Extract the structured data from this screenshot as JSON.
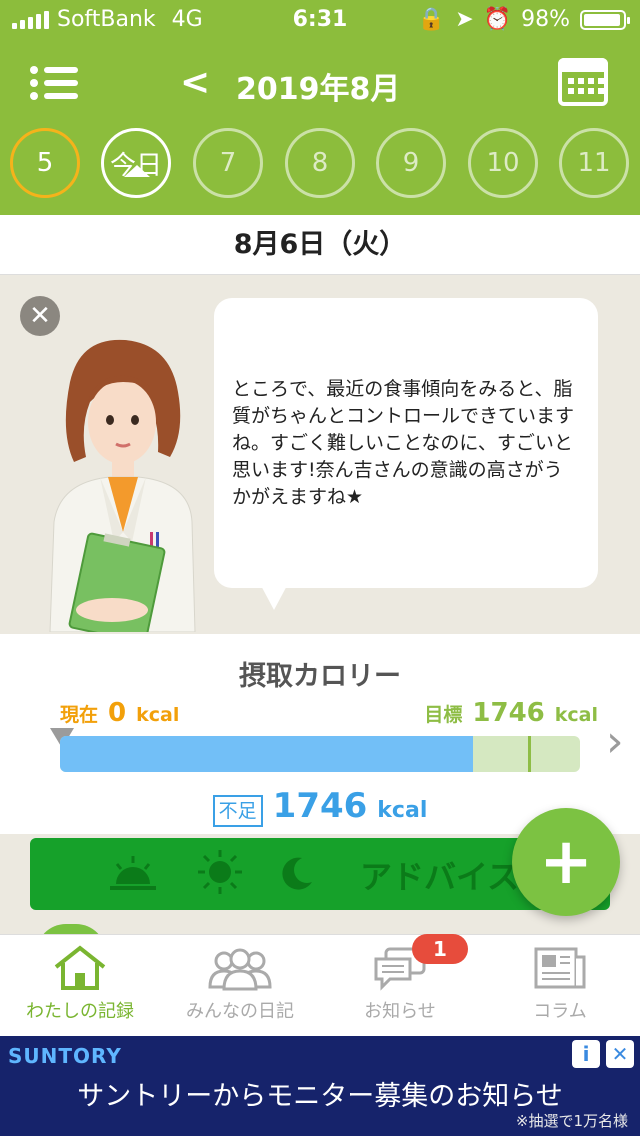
{
  "status_bar": {
    "carrier": "SoftBank",
    "network": "4G",
    "time": "6:31",
    "battery": "98%"
  },
  "header": {
    "title": "2019年8月",
    "back_icon": "chevron-left-icon",
    "menu_icon": "menu-icon",
    "calendar_icon": "calendar-icon"
  },
  "days": [
    {
      "label": "5",
      "state": "past"
    },
    {
      "label": "今日",
      "state": "today"
    },
    {
      "label": "7",
      "state": "future"
    },
    {
      "label": "8",
      "state": "future"
    },
    {
      "label": "9",
      "state": "future"
    },
    {
      "label": "10",
      "state": "future"
    },
    {
      "label": "11",
      "state": "future"
    }
  ],
  "date_label": "8月6日（火）",
  "advice": {
    "message": "ところで、最近の食事傾向をみると、脂質がちゃんとコントロールできていますね。すごく難しいことなのに、すごいと思います!奈ん吉さんの意識の高さがうかがえますね★",
    "close_icon": "close-icon"
  },
  "calories": {
    "title": "摂取カロリー",
    "current_label": "現在",
    "current_value": "0",
    "goal_label": "目標",
    "goal_value": "1746",
    "unit": "kcal",
    "deficit_label": "不足",
    "deficit_value": "1746",
    "bar_fill_fraction": 0.795,
    "bar_goal_fraction": 0.9
  },
  "meals": {
    "advice_label": "アドバイス",
    "icons": [
      "sunrise-icon",
      "sun-icon",
      "moon-icon"
    ]
  },
  "fab_label": "+",
  "tabs": [
    {
      "label": "わたしの記録",
      "icon": "house-icon",
      "active": true
    },
    {
      "label": "みんなの日記",
      "icon": "people-icon",
      "active": false
    },
    {
      "label": "お知らせ",
      "icon": "chat-icon",
      "active": false
    },
    {
      "label": "コラム",
      "icon": "newspaper-icon",
      "active": false
    }
  ],
  "notification_badge": "1",
  "ad": {
    "brand": "SUNTORY",
    "headline": "サントリーからモニター募集のお知らせ",
    "note": "※抽選で1万名様"
  },
  "colors": {
    "primary_green": "#8cbd3c",
    "accent_orange": "#f2a00a",
    "bar_blue": "#72bff7",
    "badge_red": "#e74c3c"
  }
}
